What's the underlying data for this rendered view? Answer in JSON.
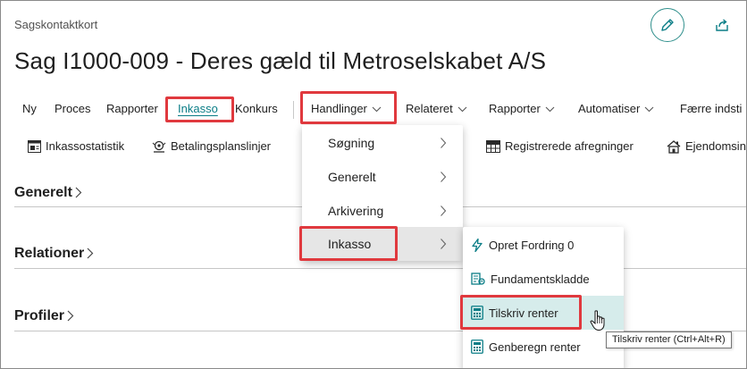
{
  "header": {
    "caption": "Sagskontaktkort",
    "title": "Sag I1000-009 - Deres gæld til Metroselskabet A/S"
  },
  "actionbar": {
    "items": [
      {
        "label": "Ny"
      },
      {
        "label": "Proces"
      },
      {
        "label": "Rapporter"
      },
      {
        "label": "Inkasso",
        "active": true
      },
      {
        "label": "Konkurs"
      },
      {
        "label": "Handlinger"
      },
      {
        "label": "Relateret"
      },
      {
        "label": "Rapporter"
      },
      {
        "label": "Automatiser"
      },
      {
        "label": "Færre indsti"
      }
    ]
  },
  "toolbar": {
    "items": [
      {
        "label": "Inkassostatistik",
        "icon": "statistics-icon"
      },
      {
        "label": "Betalingsplanslinjer",
        "icon": "payment-plan-icon"
      },
      {
        "label": "Registrerede afregninger",
        "icon": "registered-settlements-icon"
      },
      {
        "label": "Ejendomsin",
        "icon": "property-icon"
      }
    ]
  },
  "sections": [
    {
      "label": "Generelt"
    },
    {
      "label": "Relationer"
    },
    {
      "label": "Profiler"
    }
  ],
  "handlinger_menu": {
    "items": [
      {
        "label": "Søgning"
      },
      {
        "label": "Generelt"
      },
      {
        "label": "Arkivering"
      },
      {
        "label": "Inkasso",
        "selected": true
      }
    ]
  },
  "inkasso_submenu": {
    "items": [
      {
        "label": "Opret Fordring 0",
        "icon": "lightning-icon"
      },
      {
        "label": "Fundamentskladde",
        "icon": "journal-icon"
      },
      {
        "label": "Tilskriv renter",
        "icon": "calculator-icon",
        "hover": true
      },
      {
        "label": "Genberegn renter",
        "icon": "calculator-icon"
      }
    ]
  },
  "tooltip": {
    "text": "Tilskriv renter (Ctrl+Alt+R)"
  },
  "colors": {
    "accent": "#0a7d86",
    "highlight_box": "#e0393e",
    "hover_bg": "#d6eceb"
  }
}
